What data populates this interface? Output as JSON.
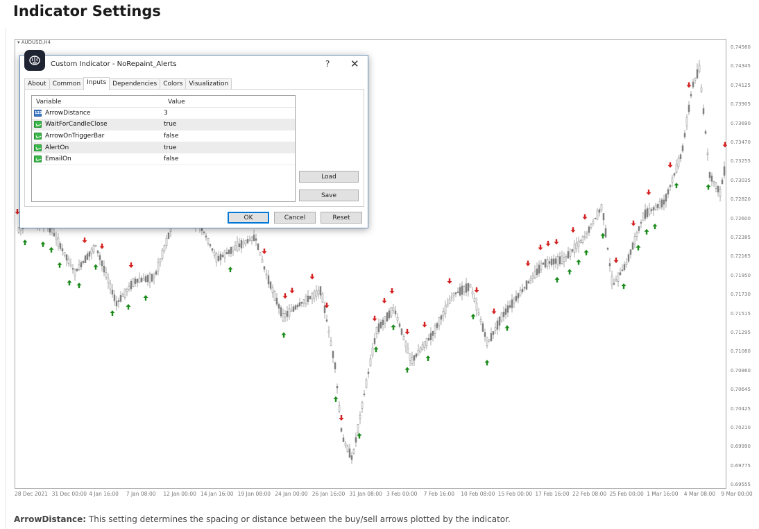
{
  "page": {
    "title": "Indicator Settings",
    "footer_term": "ArrowDistance:",
    "footer_text": " This setting determines the spacing or distance between the buy/sell arrows plotted by the indicator."
  },
  "chart": {
    "symbol": "AUDUSD,H4",
    "price_labels": [
      "0.74560",
      "0.74345",
      "0.74125",
      "0.73905",
      "0.73690",
      "0.73470",
      "0.73255",
      "0.73035",
      "0.72820",
      "0.72600",
      "0.72385",
      "0.72165",
      "0.71950",
      "0.71730",
      "0.71515",
      "0.71295",
      "0.71080",
      "0.70860",
      "0.70645",
      "0.70425",
      "0.70210",
      "0.69990",
      "0.69775",
      "0.69555"
    ],
    "date_labels": [
      "28 Dec 2021",
      "31 Dec 00:00",
      "4 Jan 16:00",
      "7 Jan 08:00",
      "12 Jan 00:00",
      "14 Jan 16:00",
      "19 Jan 08:00",
      "24 Jan 00:00",
      "26 Jan 16:00",
      "31 Jan 08:00",
      "3 Feb 00:00",
      "7 Feb 16:00",
      "10 Feb 08:00",
      "15 Feb 00:00",
      "17 Feb 16:00",
      "22 Feb 08:00",
      "25 Feb 00:00",
      "1 Mar 16:00",
      "4 Mar 08:00",
      "9 Mar 00:00"
    ],
    "colors": {
      "candle": "#7f7f7f",
      "buy_arrow": "#1a8a1a",
      "sell_arrow": "#d42020",
      "grid_border": "#a8a8a8"
    },
    "ylim": [
      0.69555,
      0.7456
    ]
  },
  "dialog": {
    "title": "Custom Indicator - NoRepaint_Alerts",
    "help_glyph": "?",
    "close_glyph": "✕",
    "badge_icon": "brain-icon",
    "tabs": [
      {
        "label": "About",
        "active": false
      },
      {
        "label": "Common",
        "active": false
      },
      {
        "label": "Inputs",
        "active": true
      },
      {
        "label": "Dependencies",
        "active": false
      },
      {
        "label": "Colors",
        "active": false
      },
      {
        "label": "Visualization",
        "active": false
      }
    ],
    "grid_headers": {
      "variable": "Variable",
      "value": "Value"
    },
    "inputs": [
      {
        "name": "ArrowDistance",
        "value": "3",
        "type": "int"
      },
      {
        "name": "WaitForCandleClose",
        "value": "true",
        "type": "bool"
      },
      {
        "name": "ArrowOnTriggerBar",
        "value": "false",
        "type": "bool"
      },
      {
        "name": "AlertOn",
        "value": "true",
        "type": "bool"
      },
      {
        "name": "EmailOn",
        "value": "false",
        "type": "bool"
      }
    ],
    "buttons": {
      "load": "Load",
      "save": "Save",
      "ok": "OK",
      "cancel": "Cancel",
      "reset": "Reset"
    }
  }
}
